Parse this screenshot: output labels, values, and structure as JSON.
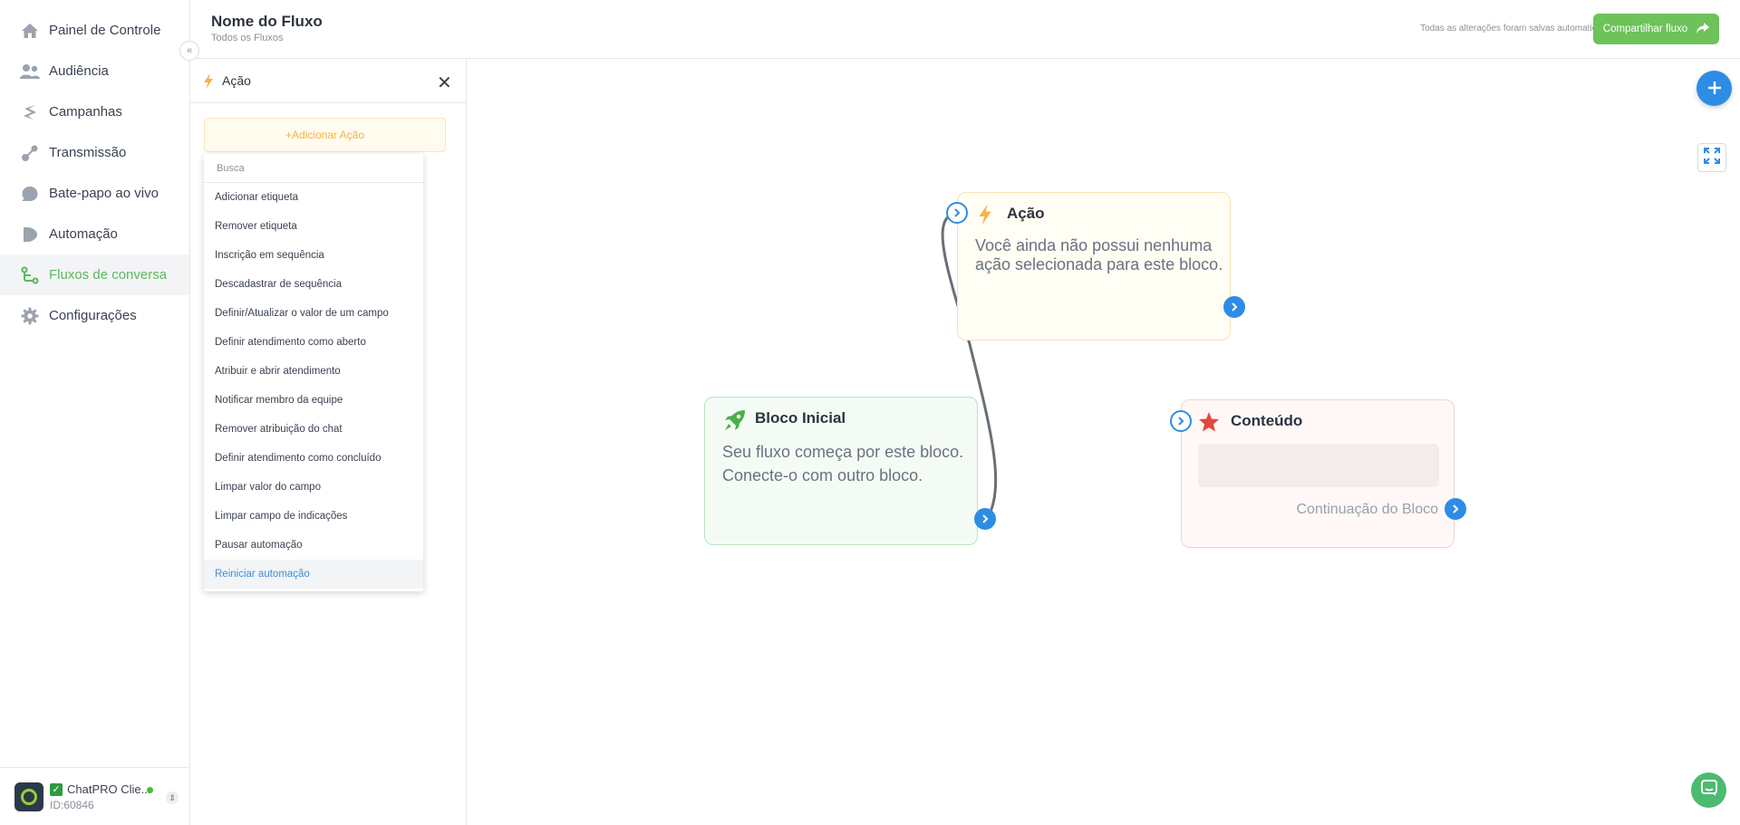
{
  "sidebar": {
    "items": [
      {
        "label": "Painel de Controle",
        "icon": "home-icon"
      },
      {
        "label": "Audiência",
        "icon": "users-icon"
      },
      {
        "label": "Campanhas",
        "icon": "campaigns-icon"
      },
      {
        "label": "Transmissão",
        "icon": "broadcast-icon"
      },
      {
        "label": "Bate-papo ao vivo",
        "icon": "chat-icon"
      },
      {
        "label": "Automação",
        "icon": "automation-icon"
      },
      {
        "label": "Fluxos de conversa",
        "icon": "flows-icon",
        "active": true
      },
      {
        "label": "Configurações",
        "icon": "gear-icon"
      }
    ],
    "collapse_icon": "«",
    "account": {
      "name": "ChatPRO Clie...",
      "id": "ID:60846",
      "status": "online"
    }
  },
  "header": {
    "title": "Nome do Fluxo",
    "breadcrumb": "Todos os Fluxos",
    "save_status": "Todas as alterações foram salvas automaticamente",
    "share_label": "Compartilhar fluxo"
  },
  "action_panel": {
    "title": "Ação",
    "add_action_label": "+Adicionar Ação",
    "search_placeholder": "Busca",
    "options": [
      "Adicionar etiqueta",
      "Remover etiqueta",
      "Inscrição em sequência",
      "Descadastrar de sequência",
      "Definir/Atualizar o valor de um campo",
      "Definir atendimento como aberto",
      "Atribuir e abrir atendimento",
      "Notificar membro da equipe",
      "Remover atribuição do chat",
      "Definir atendimento como concluído",
      "Limpar valor do campo",
      "Limpar campo de indicações",
      "Pausar automação",
      "Reiniciar automação"
    ],
    "highlighted_option": "Reiniciar automação"
  },
  "canvas": {
    "nodes": {
      "action": {
        "title": "Ação",
        "body": "Você ainda não possui nenhuma ação selecionada para este bloco."
      },
      "start": {
        "title": "Bloco Inicial",
        "body": "Seu fluxo começa por este bloco. Conecte-o com outro bloco."
      },
      "content": {
        "title": "Conteúdo",
        "continuation": "Continuação do Bloco"
      }
    }
  },
  "colors": {
    "accent_green": "#5cb85c",
    "share_green": "#6dc25a",
    "primary_blue": "#2d8de4",
    "action_yellow": "#f0b44c",
    "content_red": "#e2483d"
  }
}
